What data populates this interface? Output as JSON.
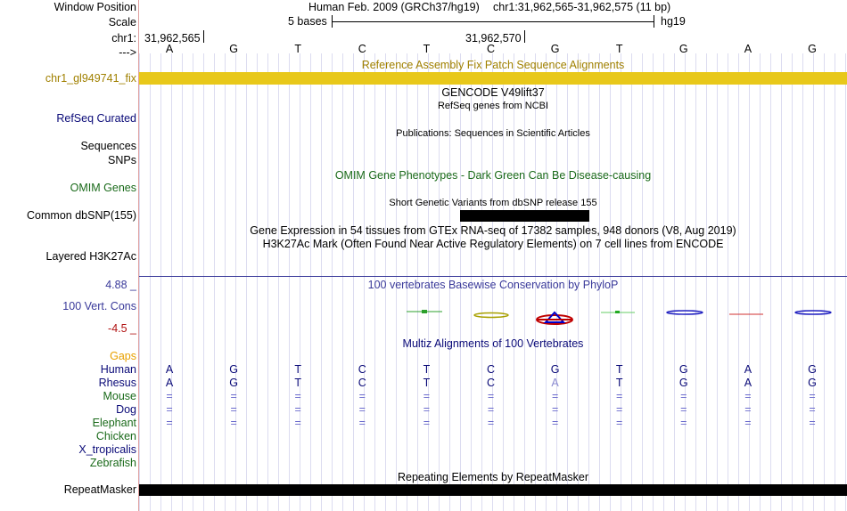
{
  "header": {
    "window_position_label": "Window Position",
    "assembly": "Human Feb. 2009 (GRCh37/hg19)",
    "position": "chr1:31,962,565-31,962,575 (11 bp)",
    "scale_label": "Scale",
    "scale_text": "5 bases",
    "db": "hg19",
    "chrom_label": "chr1:",
    "coord1": "31,962,565",
    "coord2": "31,962,570",
    "arrow_label": "--->"
  },
  "bases": [
    "A",
    "G",
    "T",
    "C",
    "T",
    "C",
    "G",
    "T",
    "G",
    "A",
    "G"
  ],
  "tracks": {
    "fix_patch_title": "Reference Assembly Fix Patch Sequence Alignments",
    "fix_patch_label": "chr1_gl949741_fix",
    "gencode_title": "GENCODE V49lift37",
    "refseq_subtitle": "RefSeq genes from NCBI",
    "refseq_label": "RefSeq Curated",
    "publications_title": "Publications: Sequences in Scientific Articles",
    "sequences_label": "Sequences",
    "snps_label": "SNPs",
    "omim_title": "OMIM Gene Phenotypes - Dark Green Can Be Disease-causing",
    "omim_label": "OMIM Genes",
    "dbsnp_title": "Short Genetic Variants from dbSNP release 155",
    "dbsnp_label": "Common dbSNP(155)",
    "gtex_title": "Gene Expression in 54 tissues from GTEx RNA-seq of 17382 samples, 948 donors (V8, Aug 2019)",
    "h3k27_title": "H3K27Ac Mark (Often Found Near Active Regulatory Elements) on 7 cell lines from ENCODE",
    "h3k27_label": "Layered H3K27Ac",
    "cons_max": "4.88 _",
    "cons_title": "100 vertebrates Basewise Conservation by PhyloP",
    "cons_label": "100 Vert. Cons",
    "cons_min": "-4.5 _",
    "multiz_title": "Multiz Alignments of 100 Vertebrates",
    "repeat_title": "Repeating Elements by RepeatMasker",
    "repeat_label": "RepeatMasker"
  },
  "species": [
    {
      "name": "Gaps",
      "color": "#e8a000",
      "bases": []
    },
    {
      "name": "Human",
      "color": "#0a0a78",
      "bases": [
        "A",
        "G",
        "T",
        "C",
        "T",
        "C",
        "G",
        "T",
        "G",
        "A",
        "G"
      ]
    },
    {
      "name": "Rhesus",
      "color": "#0a0a78",
      "bases": [
        "A",
        "G",
        "T",
        "C",
        "T",
        "C",
        "A",
        "T",
        "G",
        "A",
        "G"
      ]
    },
    {
      "name": "Mouse",
      "color": "#1a6a1a",
      "bases": [
        "=",
        "=",
        "=",
        "=",
        "=",
        "=",
        "=",
        "=",
        "=",
        "=",
        "="
      ]
    },
    {
      "name": "Dog",
      "color": "#0a0a78",
      "bases": [
        "=",
        "=",
        "=",
        "=",
        "=",
        "=",
        "=",
        "=",
        "=",
        "=",
        "="
      ]
    },
    {
      "name": "Elephant",
      "color": "#1a6a1a",
      "bases": [
        "=",
        "=",
        "=",
        "=",
        "=",
        "=",
        "=",
        "=",
        "=",
        "=",
        "="
      ]
    },
    {
      "name": "Chicken",
      "color": "#1a6a1a",
      "bases": []
    },
    {
      "name": "X_tropicalis",
      "color": "#0a0a78",
      "bases": []
    },
    {
      "name": "Zebrafish",
      "color": "#1a6a1a",
      "bases": []
    }
  ],
  "colors": {
    "fix_patch": "#e8c81a",
    "label_gold": "#a08000",
    "label_navy": "#0a0a78",
    "label_green": "#1a6a1a",
    "cons_blue": "#3a3a9a",
    "cons_red": "#b01010"
  }
}
